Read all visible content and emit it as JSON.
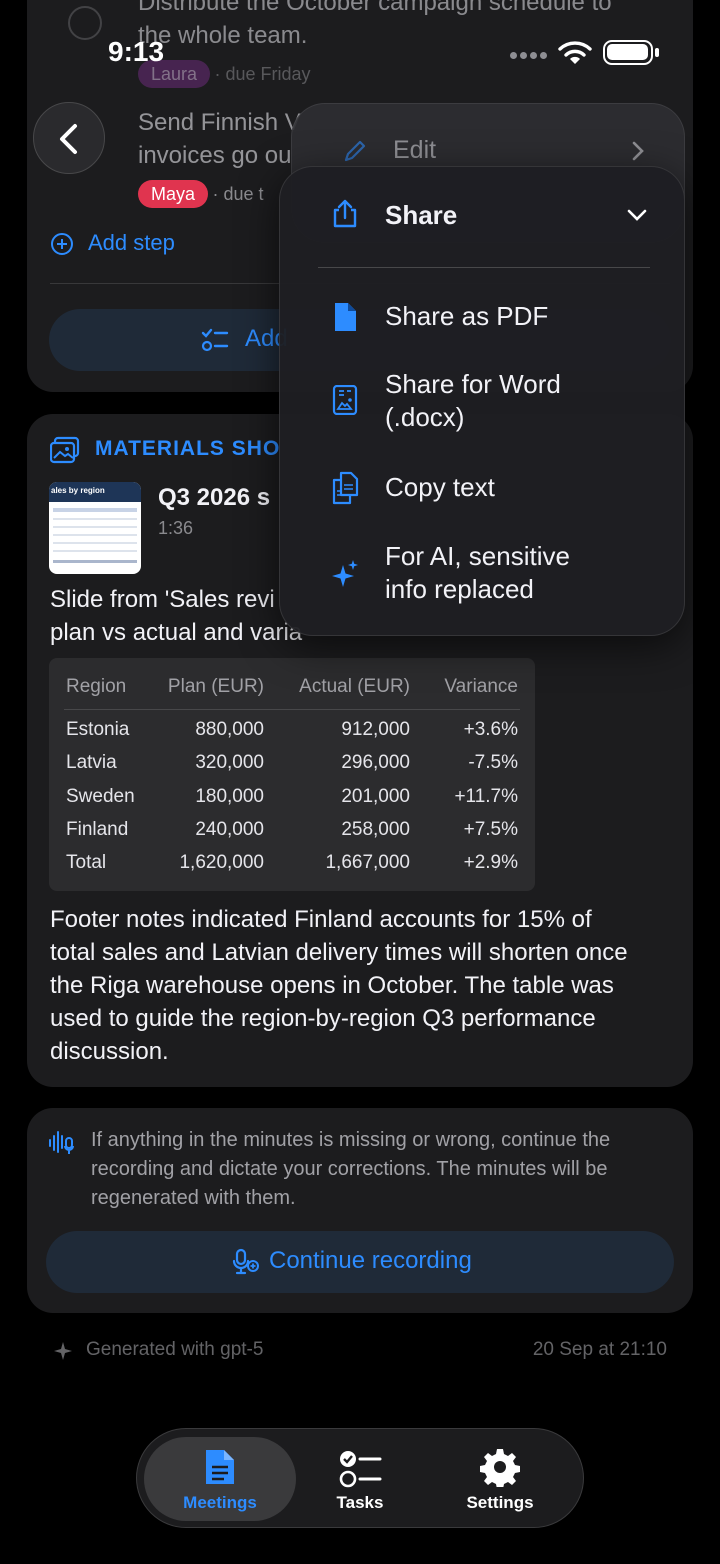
{
  "status_bar": {
    "time": "9:13"
  },
  "tasks": [
    {
      "text_line1": "Distribute the October campaign schedule to",
      "text_line2": "the whole team.",
      "assignee": "Laura",
      "due": "· due Friday"
    },
    {
      "text_line1": "Send Finnish V",
      "text_line2": "invoices go ou",
      "assignee": "Maya",
      "due": "· due t"
    }
  ],
  "add_step_label": "Add step",
  "add_tasks_label": "Add",
  "materials": {
    "section_title": "MATERIALS SHO",
    "thumb_title": "ales by region",
    "item_title": "Q3 2026 s",
    "item_time": "1:36",
    "desc_line1": "Slide from 'Sales revi",
    "desc_line2": "plan vs actual and varia",
    "table": {
      "headers": [
        "Region",
        "Plan (EUR)",
        "Actual (EUR)",
        "Variance"
      ],
      "rows": [
        [
          "Estonia",
          "880,000",
          "912,000",
          "+3.6%"
        ],
        [
          "Latvia",
          "320,000",
          "296,000",
          "-7.5%"
        ],
        [
          "Sweden",
          "180,000",
          "201,000",
          "+11.7%"
        ],
        [
          "Finland",
          "240,000",
          "258,000",
          "+7.5%"
        ],
        [
          "Total",
          "1,620,000",
          "1,667,000",
          "+2.9%"
        ]
      ]
    },
    "footer_lines": [
      "Footer notes indicated Finland accounts for 15% of",
      "total sales and Latvian delivery times will shorten once",
      "the Riga warehouse opens in October. The table was",
      "used to guide the region-by-region Q3 performance",
      "discussion."
    ]
  },
  "correction": {
    "lines": [
      "If anything in the minutes is missing or wrong, continue the",
      "recording and dictate your corrections. The minutes will be",
      "regenerated with them."
    ],
    "button_label": "Continue recording"
  },
  "footer": {
    "generated": "Generated with gpt-5",
    "timestamp": "20 Sep at 21:10"
  },
  "tabs": [
    {
      "label": "Meetings",
      "icon": "document-icon",
      "active": true
    },
    {
      "label": "Tasks",
      "icon": "checklist-icon",
      "active": false
    },
    {
      "label": "Settings",
      "icon": "gear-icon",
      "active": false
    }
  ],
  "menu": {
    "edit_label": "Edit",
    "share_label": "Share",
    "items": [
      {
        "label": "Share as PDF",
        "icon": "pdf-file-icon"
      },
      {
        "label_line1": "Share for Word",
        "label_line2": "(.docx)",
        "icon": "word-doc-icon"
      },
      {
        "label": "Copy text",
        "icon": "copy-icon"
      },
      {
        "label_line1": "For AI, sensitive",
        "label_line2": "info replaced",
        "icon": "sparkle-icon"
      }
    ]
  },
  "colors": {
    "accent": "#2d8cff",
    "maya_chip": "#e0344f",
    "laura_chip": "#8e44ad"
  }
}
